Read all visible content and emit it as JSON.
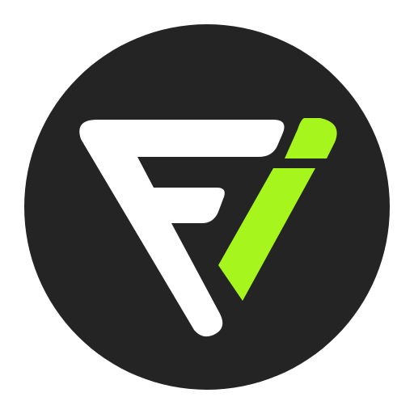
{
  "logo": {
    "name": "fi-monogram-logo",
    "colors": {
      "background": "#ffffff",
      "disc": "#242424",
      "letter_f": "#ffffff",
      "letter_i": "#a6f51c"
    }
  }
}
